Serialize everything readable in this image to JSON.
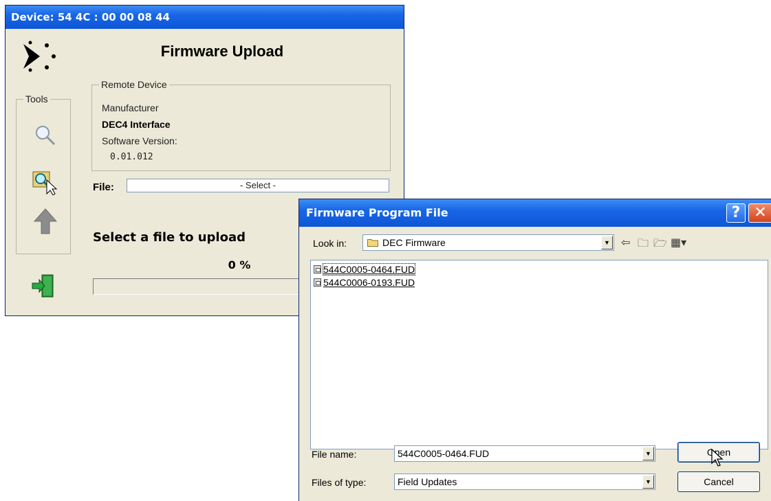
{
  "main_window": {
    "title": "Device:  54 4C : 00 00 08 44",
    "heading": "Firmware Upload",
    "tools_legend": "Tools",
    "remote_device": {
      "legend": "Remote Device",
      "manufacturer_label": "Manufacturer",
      "manufacturer_value": "DEC4 Interface",
      "software_label": "Software Version:",
      "software_value": "0.01.012"
    },
    "file_label": "File:",
    "file_placeholder": "- Select -",
    "status": "Select a file to upload",
    "progress_text": "0 %",
    "progress": 0
  },
  "dialog": {
    "title": "Firmware Program File",
    "help_glyph": "?",
    "close_glyph": "✕",
    "look_in_label": "Look in:",
    "look_in_value": "DEC Firmware",
    "files": [
      "544C0005-0464.FUD",
      "544C0006-0193.FUD"
    ],
    "file_name_label": "File name:",
    "file_name_value": "544C0005-0464.FUD",
    "files_of_type_label": "Files of type:",
    "files_of_type_value": "Field Updates",
    "open_label": "Open",
    "cancel_label": "Cancel",
    "icons": [
      "back-arrow-icon",
      "up-folder-icon",
      "new-folder-icon",
      "view-menu-icon"
    ]
  }
}
